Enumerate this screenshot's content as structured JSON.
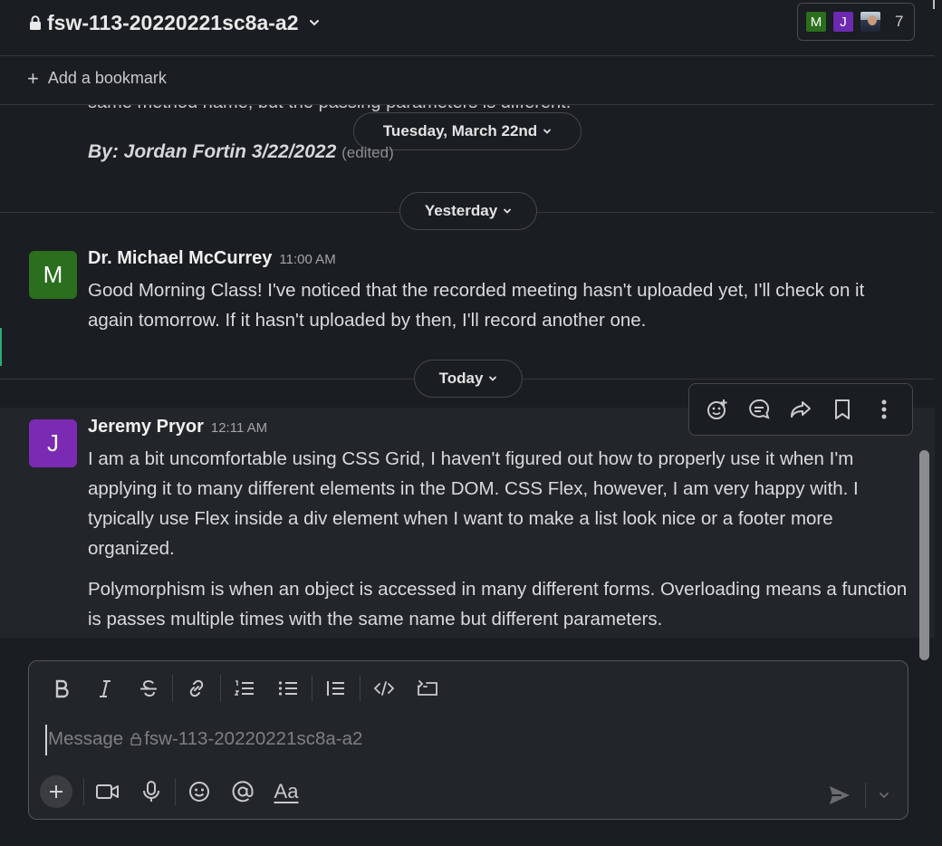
{
  "header": {
    "channel_name": "fsw-113-20220221sc8a-a2",
    "member_avatars": [
      "M",
      "J"
    ],
    "member_count": "7"
  },
  "bookmarks": {
    "add_label": "Add a bookmark"
  },
  "messages": {
    "previous_cut_line": "same method name, but the passing parameters is different.",
    "previous_signature": "By: Jordan Fortin 3/22/2022",
    "previous_edited": "(edited)",
    "dividers": {
      "d1": "Tuesday, March 22nd",
      "d2": "Yesterday",
      "d3": "Today"
    },
    "m1": {
      "avatar": "M",
      "avatar_color": "#2b6e1e",
      "sender": "Dr. Michael McCurrey",
      "time": "11:00 AM",
      "text": "Good Morning Class!  I've noticed that the recorded meeting hasn't uploaded yet, I'll check on it again tomorrow.  If it hasn't uploaded by then, I'll record another one."
    },
    "m2": {
      "avatar": "J",
      "avatar_color": "#7b2bb3",
      "sender": "Jeremy Pryor",
      "time": "12:11 AM",
      "p1": "I am a bit uncomfortable using CSS Grid, I haven't figured out how to properly use it when I'm applying it to many different elements in the DOM. CSS Flex, however, I am very happy with. I typically use Flex inside a div element when I want to make a list look nice or a footer more organized.",
      "p2": "Polymorphism is when an object is accessed in many different forms. Overloading means a function is passes multiple times with the same name but different parameters."
    }
  },
  "message_actions": [
    "add-reaction-icon",
    "reply-in-thread-icon",
    "share-icon",
    "save-icon",
    "more-actions-icon"
  ],
  "composer": {
    "placeholder_prefix": "Message",
    "placeholder_channel": "fsw-113-20220221sc8a-a2",
    "value": "",
    "format_label": "Aa"
  }
}
